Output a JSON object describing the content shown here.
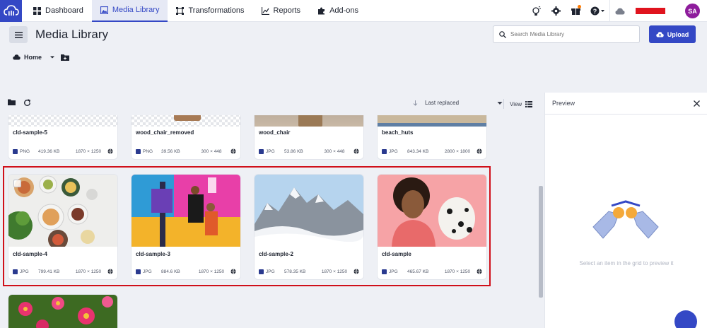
{
  "nav": {
    "items": [
      {
        "label": "Dashboard",
        "icon": "dashboard-icon",
        "active": false
      },
      {
        "label": "Media Library",
        "icon": "media-library-icon",
        "active": true
      },
      {
        "label": "Transformations",
        "icon": "transformations-icon",
        "active": false
      },
      {
        "label": "Reports",
        "icon": "reports-icon",
        "active": false
      },
      {
        "label": "Add-ons",
        "icon": "addons-icon",
        "active": false
      }
    ],
    "avatar_initials": "SA"
  },
  "header": {
    "title": "Media Library",
    "search_placeholder": "Search Media Library",
    "upload_label": "Upload"
  },
  "breadcrumb": {
    "home": "Home"
  },
  "toolbar": {
    "sort_label": "Last replaced",
    "view_label": "View"
  },
  "assets": [
    {
      "name": "cld-sample-5",
      "format": "PNG",
      "size": "419.36 KB",
      "dims": "1870 × 1250"
    },
    {
      "name": "wood_chair_removed",
      "format": "PNG",
      "size": "39.56 KB",
      "dims": "300 × 448"
    },
    {
      "name": "wood_chair",
      "format": "JPG",
      "size": "53.86 KB",
      "dims": "300 × 448"
    },
    {
      "name": "beach_huts",
      "format": "JPG",
      "size": "843.34 KB",
      "dims": "2800 × 1800"
    },
    {
      "name": "cld-sample-4",
      "format": "JPG",
      "size": "799.41 KB",
      "dims": "1870 × 1250"
    },
    {
      "name": "cld-sample-3",
      "format": "JPG",
      "size": "884.6 KB",
      "dims": "1870 × 1250"
    },
    {
      "name": "cld-sample-2",
      "format": "JPG",
      "size": "578.35 KB",
      "dims": "1870 × 1250"
    },
    {
      "name": "cld-sample",
      "format": "JPG",
      "size": "465.67 KB",
      "dims": "1870 × 1250"
    }
  ],
  "preview": {
    "title": "Preview",
    "empty_text": "Select an item in the grid to preview it"
  },
  "colors": {
    "accent": "#3448c5",
    "selection": "#d0101a",
    "avatar": "#8e1c9c"
  }
}
